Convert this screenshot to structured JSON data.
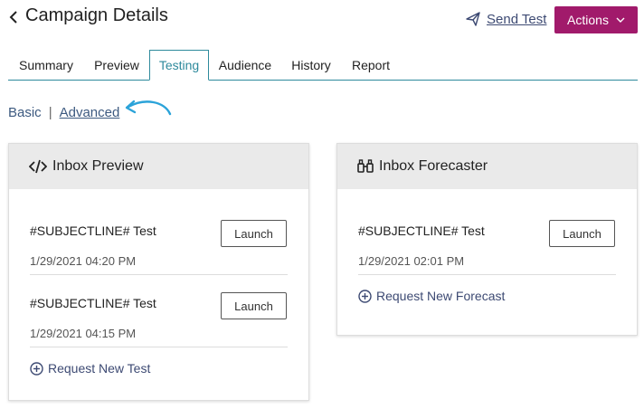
{
  "header": {
    "title": "Campaign Details",
    "send_test_label": "Send Test",
    "actions_label": "Actions"
  },
  "tabs": [
    {
      "label": "Summary",
      "active": false
    },
    {
      "label": "Preview",
      "active": false
    },
    {
      "label": "Testing",
      "active": true
    },
    {
      "label": "Audience",
      "active": false
    },
    {
      "label": "History",
      "active": false
    },
    {
      "label": "Report",
      "active": false
    }
  ],
  "mode": {
    "basic_label": "Basic",
    "separator": "|",
    "advanced_label": "Advanced"
  },
  "inbox_preview": {
    "title": "Inbox Preview",
    "items": [
      {
        "subject": "#SUBJECTLINE# Test",
        "timestamp": "1/29/2021 04:20 PM",
        "button": "Launch"
      },
      {
        "subject": "#SUBJECTLINE# Test",
        "timestamp": "1/29/2021 04:15 PM",
        "button": "Launch"
      }
    ],
    "request_label": "Request New Test"
  },
  "inbox_forecaster": {
    "title": "Inbox Forecaster",
    "items": [
      {
        "subject": "#SUBJECTLINE# Test",
        "timestamp": "1/29/2021 02:01 PM",
        "button": "Launch"
      }
    ],
    "request_label": "Request New Forecast"
  },
  "colors": {
    "accent_teal": "#2e8a9c",
    "actions_bg": "#a11a6b",
    "link_blue": "#3d4a73",
    "arrow_blue": "#2ba3d9"
  },
  "icons": {
    "back": "chevron-left-icon",
    "send": "paper-plane-icon",
    "actions_caret": "chevron-down-icon",
    "preview": "code-icon",
    "forecaster": "binoculars-icon",
    "request": "plus-circle-icon",
    "annotation": "curved-arrow-icon"
  }
}
